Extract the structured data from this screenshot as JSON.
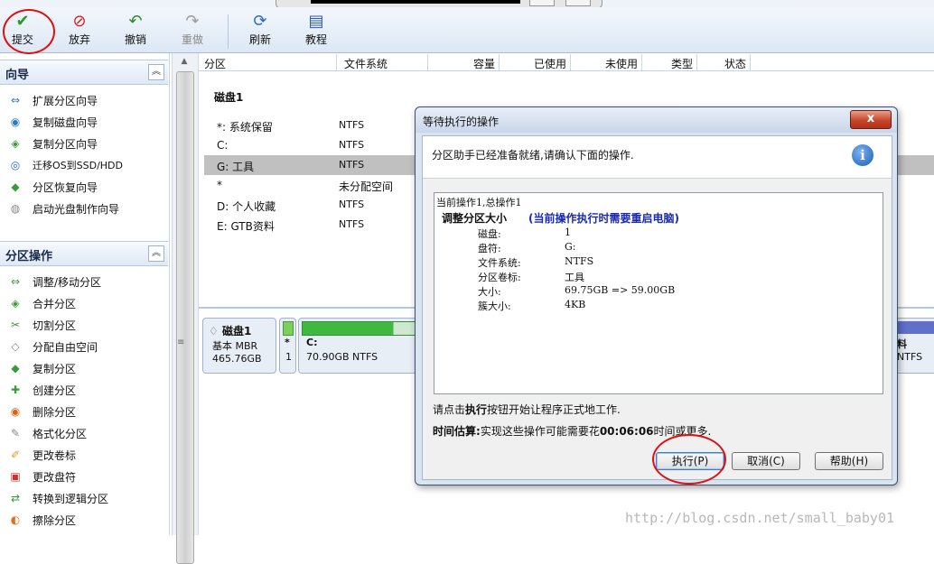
{
  "toolbar": {
    "buttons": [
      {
        "label": "提交",
        "icon": "checkmark-icon"
      },
      {
        "label": "放弃",
        "icon": "discard-icon"
      },
      {
        "label": "撤销",
        "icon": "undo-icon"
      },
      {
        "label": "重做",
        "icon": "redo-icon"
      },
      {
        "label": "刷新",
        "icon": "refresh-icon"
      },
      {
        "label": "教程",
        "icon": "tutorial-icon"
      }
    ]
  },
  "wizard_section": {
    "title": "向导",
    "items": [
      {
        "label": "扩展分区向导"
      },
      {
        "label": "复制磁盘向导"
      },
      {
        "label": "复制分区向导"
      },
      {
        "label": "迁移OS到SSD/HDD"
      },
      {
        "label": "分区恢复向导"
      },
      {
        "label": "启动光盘制作向导"
      }
    ]
  },
  "partition_section": {
    "title": "分区操作",
    "items": [
      {
        "label": "调整/移动分区"
      },
      {
        "label": "合并分区"
      },
      {
        "label": "切割分区"
      },
      {
        "label": "分配自由空间"
      },
      {
        "label": "复制分区"
      },
      {
        "label": "创建分区"
      },
      {
        "label": "删除分区"
      },
      {
        "label": "格式化分区"
      },
      {
        "label": "更改卷标"
      },
      {
        "label": "更改盘符"
      },
      {
        "label": "转换到逻辑分区"
      },
      {
        "label": "擦除分区"
      }
    ]
  },
  "table": {
    "columns": [
      "分区",
      "文件系统",
      "容量",
      "已使用",
      "未使用",
      "类型",
      "状态"
    ],
    "disk_label": "磁盘1",
    "rows": [
      {
        "name": "*: 系统保留",
        "fs": "NTFS"
      },
      {
        "name": "C:",
        "fs": "NTFS"
      },
      {
        "name": "G: 工具",
        "fs": "NTFS"
      },
      {
        "name": "*",
        "fs": "未分配空间"
      },
      {
        "name": "D: 个人收藏",
        "fs": "NTFS"
      },
      {
        "name": "E: GTB资料",
        "fs": "NTFS"
      }
    ],
    "selected_row": 2
  },
  "diskmap": {
    "disk_name": "磁盘1",
    "disk_type": "基本 MBR",
    "disk_size": "465.76GB",
    "part1_star": "*",
    "part1_num": "1",
    "part2_label": "C:",
    "part2_info": "70.90GB NTFS",
    "part2_used_fraction": 0.75,
    "right_label": "料",
    "right_info": "NTFS"
  },
  "dialog": {
    "title": "等待执行的操作",
    "close_label": "x",
    "header_text": "分区助手已经准备就绪,请确认下面的操作.",
    "op_line": "当前操作1,总操作1",
    "op_title": "调整分区大小",
    "op_note": "(当前操作执行时需要重启电脑)",
    "details": [
      {
        "k": "磁盘:",
        "v": "1"
      },
      {
        "k": "盘符:",
        "v": "G:"
      },
      {
        "k": "文件系统:",
        "v": "NTFS"
      },
      {
        "k": "分区卷标:",
        "v": "工具"
      },
      {
        "k": "大小:",
        "v": "69.75GB => 59.00GB"
      },
      {
        "k": "簇大小:",
        "v": "4KB"
      }
    ],
    "note_prefix": "请点击",
    "note_bold": "执行",
    "note_suffix": "按钮开始让程序正式地工作.",
    "time_label": "时间估算:",
    "time_prefix": "实现这些操作可能需要花",
    "time_value": "00:06:06",
    "time_suffix": "时间或更多.",
    "execute_label": "执行(P)",
    "cancel_label": "取消(C)",
    "help_label": "帮助(H)"
  },
  "watermark": "http://blog.csdn.net/small_baby01",
  "colors": {
    "accent_red": "#e01010",
    "selected_row": "#c0c0c0",
    "close_red": "#c8452a"
  }
}
